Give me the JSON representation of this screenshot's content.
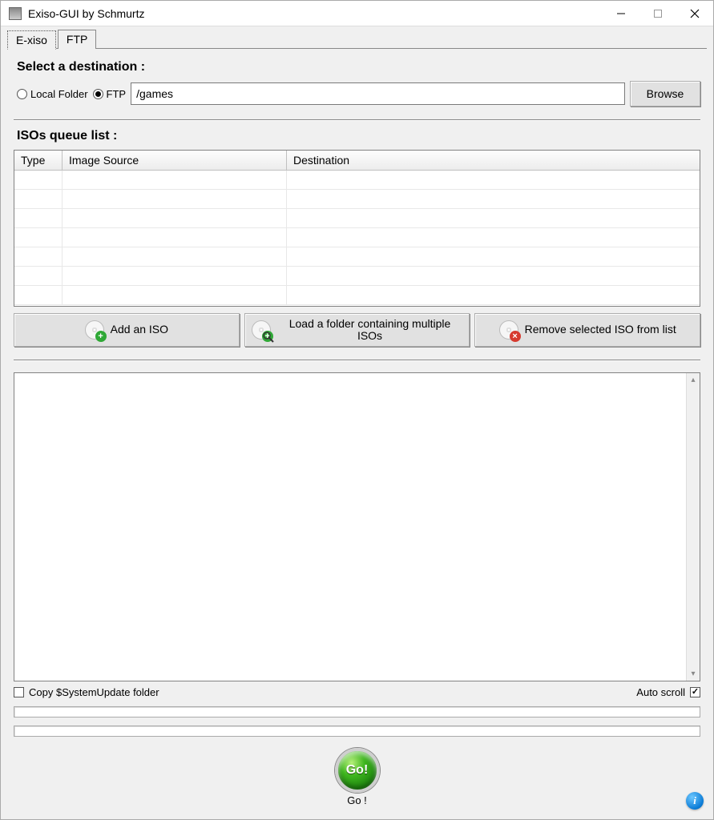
{
  "window": {
    "title": "Exiso-GUI by Schmurtz"
  },
  "tabs": [
    {
      "label": "E-xiso",
      "active": true
    },
    {
      "label": "FTP",
      "active": false
    }
  ],
  "destination": {
    "heading": "Select a destination :",
    "options": {
      "local_label": "Local Folder",
      "ftp_label": "FTP"
    },
    "selected": "ftp",
    "path_value": "/games",
    "browse_label": "Browse"
  },
  "queue": {
    "heading": "ISOs queue list :",
    "columns": {
      "type": "Type",
      "source": "Image Source",
      "destination": "Destination"
    },
    "rows": []
  },
  "buttons": {
    "add_iso": "Add an ISO",
    "load_folder": "Load a folder containing multiple ISOs",
    "remove_iso": "Remove selected ISO from list"
  },
  "options": {
    "copy_systemupdate_label": "Copy $SystemUpdate folder",
    "copy_systemupdate_checked": false,
    "auto_scroll_label": "Auto scroll",
    "auto_scroll_checked": true
  },
  "go": {
    "button_text": "Go!",
    "label": "Go !"
  },
  "info_icon_glyph": "i"
}
